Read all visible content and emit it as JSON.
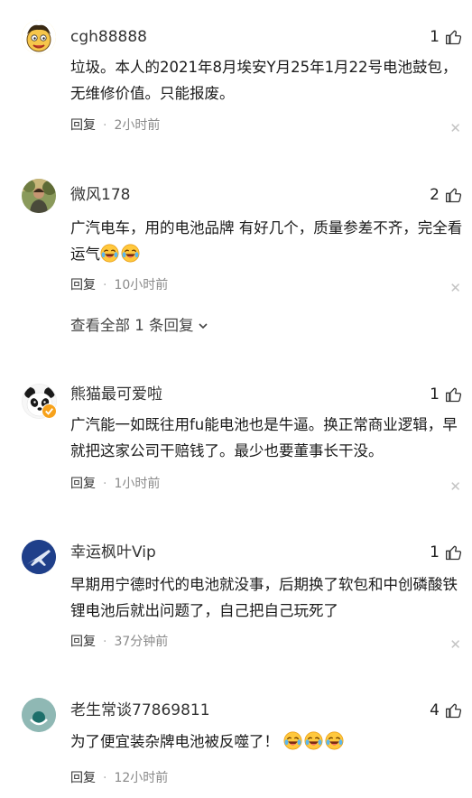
{
  "comments": [
    {
      "username": "cgh88888",
      "likes": "1",
      "text": "垃圾。本人的2021年8月埃安Y月25年1月22号电池鼓包，无维修价值。只能报废。",
      "reply_label": "回复",
      "time": "2小时前",
      "avatar_icon": "cartoon-face-avatar"
    },
    {
      "username": "微风178",
      "likes": "2",
      "text": "广汽电车，用的电池品牌 有好几个，质量参差不齐，完全看运气",
      "emojis": [
        "laughing-crying-emoji",
        "laughing-crying-emoji"
      ],
      "reply_label": "回复",
      "time": "10小时前",
      "view_all": "查看全部 1 条回复",
      "avatar_icon": "person-photo-avatar"
    },
    {
      "username": "熊猫最可爱啦",
      "likes": "1",
      "text": "广汽能一如既往用fu能电池也是牛逼。换正常商业逻辑，早就把这家公司干赔钱了。最少也要董事长干没。",
      "reply_label": "回复",
      "time": "1小时前",
      "avatar_icon": "panda-avatar"
    },
    {
      "username": "幸运枫叶Vip",
      "likes": "1",
      "text": "早期用宁德时代的电池就没事，后期换了软包和中创磷酸铁锂电池后就出问题了，自己把自己玩死了",
      "reply_label": "回复",
      "time": "37分钟前",
      "avatar_icon": "jet-avatar"
    },
    {
      "username": "老生常谈77869811",
      "likes": "4",
      "text": "为了便宜装杂牌电池被反噬了！",
      "emojis": [
        "laughing-crying-emoji",
        "laughing-crying-emoji",
        "laughing-crying-emoji"
      ],
      "reply_label": "回复",
      "time": "12小时前",
      "avatar_icon": "default-avatar"
    }
  ],
  "colors": {
    "text": "#1a1a1a",
    "meta": "#8a8a8a",
    "close": "#c4c4c4"
  }
}
